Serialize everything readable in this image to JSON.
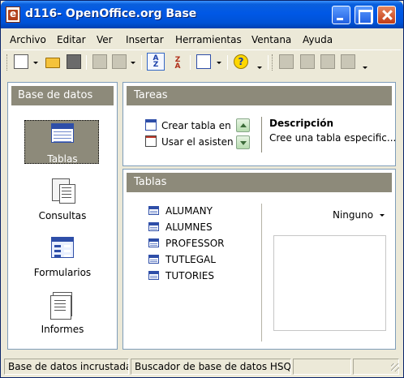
{
  "window": {
    "title": "d116- OpenOffice.org Base",
    "accent": "#0058e6"
  },
  "menu": [
    "Archivo",
    "Editar",
    "Ver",
    "Insertar",
    "Herramientas",
    "Ventana",
    "Ayuda"
  ],
  "toolbar": {
    "icons": [
      "new-document-icon",
      "open-folder-icon",
      "save-disk-icon",
      "copy-icon",
      "paste-icon",
      "sort-ascending-icon",
      "sort-descending-icon",
      "form-design-icon",
      "help-icon",
      "edit-icon",
      "open-object-icon",
      "delete-icon",
      "rename-icon"
    ]
  },
  "sidebar": {
    "title": "Base de datos",
    "items": [
      {
        "label": "Tablas",
        "icon": "table-icon",
        "selected": true
      },
      {
        "label": "Consultas",
        "icon": "query-icon",
        "selected": false
      },
      {
        "label": "Formularios",
        "icon": "form-icon",
        "selected": false
      },
      {
        "label": "Informes",
        "icon": "report-icon",
        "selected": false
      }
    ]
  },
  "tasks": {
    "title": "Tareas",
    "items": [
      "Crear tabla en vista Diseño...",
      "Usar el asistente para crear tabla..."
    ],
    "description_title": "Descripción",
    "description_text": "Cree una tabla especific..."
  },
  "tables": {
    "title": "Tablas",
    "items": [
      "ALUMANY",
      "ALUMNES",
      "PROFESSOR",
      "TUTLEGAL",
      "TUTORIES"
    ],
    "preview_selected": "Ninguno"
  },
  "status": {
    "cell1": "Base de datos incrustada",
    "cell2": "Buscador de base de datos HSQL",
    "cell3": "",
    "cell4": ""
  }
}
